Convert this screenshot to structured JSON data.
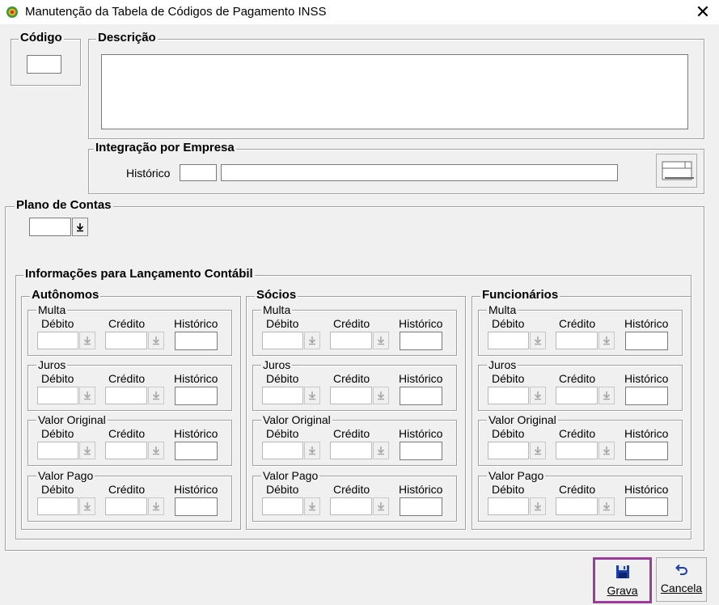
{
  "window": {
    "title": "Manutenção da Tabela de Códigos de Pagamento INSS",
    "close_glyph": "✕"
  },
  "codigo": {
    "label": "Código",
    "value": ""
  },
  "descricao": {
    "label": "Descrição",
    "value": ""
  },
  "integracao": {
    "label": "Integração  por Empresa",
    "historico_label": "Histórico",
    "historico_code": "",
    "historico_desc": ""
  },
  "plano": {
    "label": "Plano de Contas",
    "value": ""
  },
  "info": {
    "label": "Informações para Lançamento Contábil",
    "groups": [
      {
        "label": "Autônomos"
      },
      {
        "label": "Sócios"
      },
      {
        "label": "Funcionários"
      }
    ],
    "sections": [
      "Multa",
      "Juros",
      "Valor Original",
      "Valor Pago"
    ],
    "col_labels": {
      "debito": "Débito",
      "credito": "Crédito",
      "historico": "Histórico"
    }
  },
  "buttons": {
    "grava": "Grava",
    "cancela": "Cancela"
  },
  "colors": {
    "highlight": "#9b3c9b",
    "accent_blue": "#1a3fa8"
  },
  "icons": {
    "app": "app-logo-icon",
    "save": "floppy-disk-icon",
    "undo": "undo-arrow-icon",
    "lookup": "table-lookup-icon",
    "dropdown": "download-arrow-icon"
  }
}
